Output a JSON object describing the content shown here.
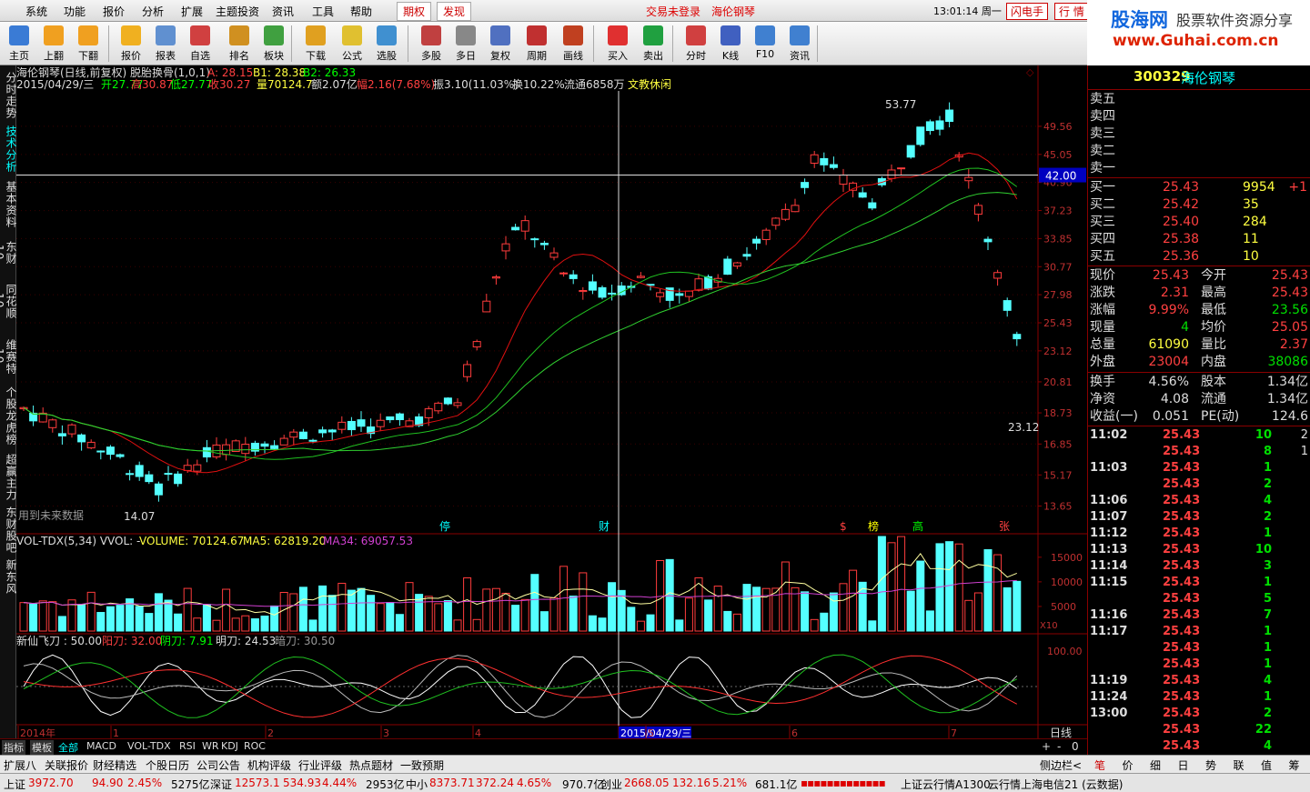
{
  "menu": {
    "items": [
      "系统",
      "功能",
      "报价",
      "分析",
      "扩展",
      "主题投资",
      "资讯",
      "工具",
      "帮助"
    ],
    "qiquan": "期权",
    "faxian": "发现",
    "trade_status": "交易未登录",
    "stock_title": "海伦钢琴",
    "time": "13:01:14 周一",
    "flash": "闪电手",
    "hangqing": "行 情"
  },
  "logo": {
    "brand": "股海网",
    "tagline": "股票软件资源分享",
    "url": "www.Guhai.com.cn"
  },
  "toolbar": [
    "主页",
    "上翻",
    "下翻",
    "报价",
    "报表",
    "自选",
    "排名",
    "板块",
    "下载",
    "公式",
    "选股",
    "多股",
    "多日",
    "复权",
    "周期",
    "画线",
    "买入",
    "卖出",
    "分时",
    "K线",
    "F10",
    "资讯"
  ],
  "leftnav": [
    "分时走势",
    "技术分析",
    "基本资料",
    "东财10",
    "同花顺10",
    "维赛特10",
    "个股龙虎榜",
    "超赢主力",
    "东财股吧",
    "新东风"
  ],
  "chart": {
    "header1": "海伦钢琴(日线,前复权) 脱胎换骨(1,0,1)",
    "a_label": "A: 28.15",
    "b1_label": "B1: 28.38",
    "b2_label": "B2: 26.33",
    "header2_date": "2015/04/29/三",
    "open": "开27.77",
    "high": "高30.87",
    "low": "低27.77",
    "close": "收30.27",
    "vol": "量70124.7",
    "amt": "额2.07亿",
    "chg": "幅2.16(7.68%)",
    "amp": "振3.10(11.03%)",
    "turn": "换10.22%",
    "float": "流通6858万",
    "theme": "文教休闲",
    "price_ticks": [
      "49.56",
      "45.05",
      "40.96",
      "37.23",
      "33.85",
      "30.77",
      "27.98",
      "25.43",
      "23.12",
      "20.81",
      "18.73",
      "16.85",
      "15.17",
      "13.65"
    ],
    "crosshair_price": "42.00",
    "high_label": "53.77",
    "low_label": "14.07",
    "last_label": "23.12",
    "future_text": "用到未来数据",
    "markers": [
      "停",
      "财",
      "$",
      "榜",
      "高",
      "张"
    ],
    "vol_header": "VOL-TDX(5,34) VVOL: -",
    "volume": "VOLUME: 70124.67",
    "ma5": "MA5: 62819.20",
    "ma34": "MA34: 69057.53",
    "vol_ticks": [
      "15000",
      "10000",
      "5000"
    ],
    "vol_unit": "X10",
    "ind_header": "新仙飞刀 : 50.00",
    "yang": "阳刀: 32.00",
    "yin": "阴刀: 7.91",
    "ming": "明刀: 24.53",
    "an": "暗刀: 30.50",
    "ind_tick": "100.00",
    "date_axis": [
      "2014年",
      "1",
      "2",
      "3",
      "4",
      "2015/04/29/三",
      "5",
      "6",
      "7"
    ],
    "period_label": "日线"
  },
  "tabs": [
    "指标",
    "模板",
    "全部",
    "MACD",
    "VOL-TDX",
    "RSI",
    "WR",
    "KDJ",
    "ROC"
  ],
  "funcbar": [
    "扩展八",
    "关联报价",
    "财经精选",
    "个股日历",
    "公司公告",
    "机构评级",
    "行业评级",
    "热点题材",
    "一致预期"
  ],
  "side_label": "侧边栏<",
  "rp_tabs": [
    "笔",
    "价",
    "细",
    "日",
    "势",
    "联",
    "值",
    "筹"
  ],
  "quote": {
    "code": "300329",
    "name": "海伦钢琴",
    "sell": [
      [
        "卖五",
        "",
        ""
      ],
      [
        "卖四",
        "",
        ""
      ],
      [
        "卖三",
        "",
        ""
      ],
      [
        "卖二",
        "",
        ""
      ],
      [
        "卖一",
        "",
        ""
      ]
    ],
    "buy": [
      [
        "买一",
        "25.43",
        "9954",
        "+1"
      ],
      [
        "买二",
        "25.42",
        "35",
        ""
      ],
      [
        "买三",
        "25.40",
        "284",
        ""
      ],
      [
        "买四",
        "25.38",
        "11",
        ""
      ],
      [
        "买五",
        "25.36",
        "10",
        ""
      ]
    ],
    "stats": [
      [
        "现价",
        "25.43",
        "今开",
        "25.43"
      ],
      [
        "涨跌",
        "2.31",
        "最高",
        "25.43"
      ],
      [
        "涨幅",
        "9.99%",
        "最低",
        "23.56"
      ],
      [
        "现量",
        "4",
        "均价",
        "25.05"
      ],
      [
        "总量",
        "61090",
        "量比",
        "2.37"
      ],
      [
        "外盘",
        "23004",
        "内盘",
        "38086"
      ]
    ],
    "fund": [
      [
        "换手",
        "4.56%",
        "股本",
        "1.34亿"
      ],
      [
        "净资",
        "4.08",
        "流通",
        "1.34亿"
      ],
      [
        "收益(一)",
        "0.051",
        "PE(动)",
        "124.6"
      ]
    ],
    "ticks": [
      [
        "11:02",
        "25.43",
        "10",
        "2"
      ],
      [
        "",
        "25.43",
        "8",
        "1"
      ],
      [
        "11:03",
        "25.43",
        "1",
        ""
      ],
      [
        "",
        "25.43",
        "2",
        ""
      ],
      [
        "11:06",
        "25.43",
        "4",
        ""
      ],
      [
        "11:07",
        "25.43",
        "2",
        ""
      ],
      [
        "11:12",
        "25.43",
        "1",
        ""
      ],
      [
        "11:13",
        "25.43",
        "10",
        ""
      ],
      [
        "11:14",
        "25.43",
        "3",
        ""
      ],
      [
        "11:15",
        "25.43",
        "1",
        ""
      ],
      [
        "",
        "25.43",
        "5",
        ""
      ],
      [
        "11:16",
        "25.43",
        "7",
        ""
      ],
      [
        "11:17",
        "25.43",
        "1",
        ""
      ],
      [
        "",
        "25.43",
        "1",
        ""
      ],
      [
        "",
        "25.43",
        "1",
        ""
      ],
      [
        "11:19",
        "25.43",
        "4",
        ""
      ],
      [
        "11:24",
        "25.43",
        "1",
        ""
      ],
      [
        "13:00",
        "25.43",
        "2",
        ""
      ],
      [
        "",
        "25.43",
        "22",
        ""
      ],
      [
        "",
        "25.43",
        "4",
        ""
      ]
    ]
  },
  "status": {
    "sh_label": "上证",
    "sh": "3972.70",
    "sh_chg": "94.90",
    "sh_pct": "2.45%",
    "sh_amt": "5275亿",
    "sz_label": "深证",
    "sz": "12573.1",
    "sz_chg": "534.93",
    "sz_pct": "4.44%",
    "sz_amt": "2953亿",
    "zx_label": "中小",
    "zx": "8373.71",
    "zx_chg": "372.24",
    "zx_pct": "4.65%",
    "zx_amt": "970.7亿",
    "cy_label": "创业",
    "cy": "2668.05",
    "cy_chg": "132.16",
    "cy_pct": "5.21%",
    "cy_amt": "681.1亿",
    "server": "上证云行情A1300",
    "server2": "云行情上海电信21 (云数据)"
  },
  "colors": {
    "up": "#ff3c3c",
    "down": "#54ffff",
    "ma_red": "#e01010",
    "ma_green": "#20c020",
    "ma_green2": "#30d030"
  },
  "chart_data": {
    "type": "candlestick",
    "source": "ohlc visualized; values approximated",
    "last_close": 23.12,
    "period_high": 53.77,
    "period_low": 14.07
  }
}
